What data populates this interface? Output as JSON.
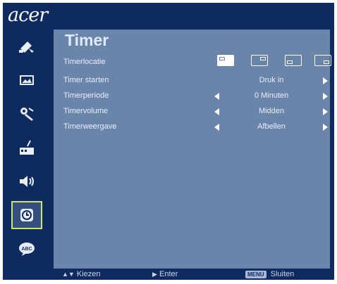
{
  "brand": {
    "logo": "acer"
  },
  "sidebar": {
    "items": [
      {
        "icon": "color-icon",
        "selected": false
      },
      {
        "icon": "image-icon",
        "selected": false
      },
      {
        "icon": "settings-icon",
        "selected": false
      },
      {
        "icon": "management-icon",
        "selected": false
      },
      {
        "icon": "audio-icon",
        "selected": false
      },
      {
        "icon": "timer-icon",
        "selected": true
      },
      {
        "icon": "language-icon",
        "selected": false
      }
    ]
  },
  "panel": {
    "title": "Timer",
    "rows": [
      {
        "label": "Timerlocatie",
        "value": ""
      },
      {
        "label": "Timer starten",
        "value": "Druk in"
      },
      {
        "label": "Timerperiode",
        "value": "0 Minuten"
      },
      {
        "label": "Timervolume",
        "value": "Midden"
      },
      {
        "label": "Timerweergave",
        "value": "Afbellen"
      }
    ],
    "timer_location_options": [
      "top-left",
      "top-right",
      "bottom-left",
      "bottom-right"
    ],
    "timer_location_selected": "top-left"
  },
  "footer": {
    "select": "Kiezen",
    "enter": "Enter",
    "menu_key": "MENU",
    "close": "Sluiten"
  },
  "colors": {
    "frame": "#0e2a5e",
    "panel": "#6b85aa",
    "selection": "#c8e86a"
  }
}
